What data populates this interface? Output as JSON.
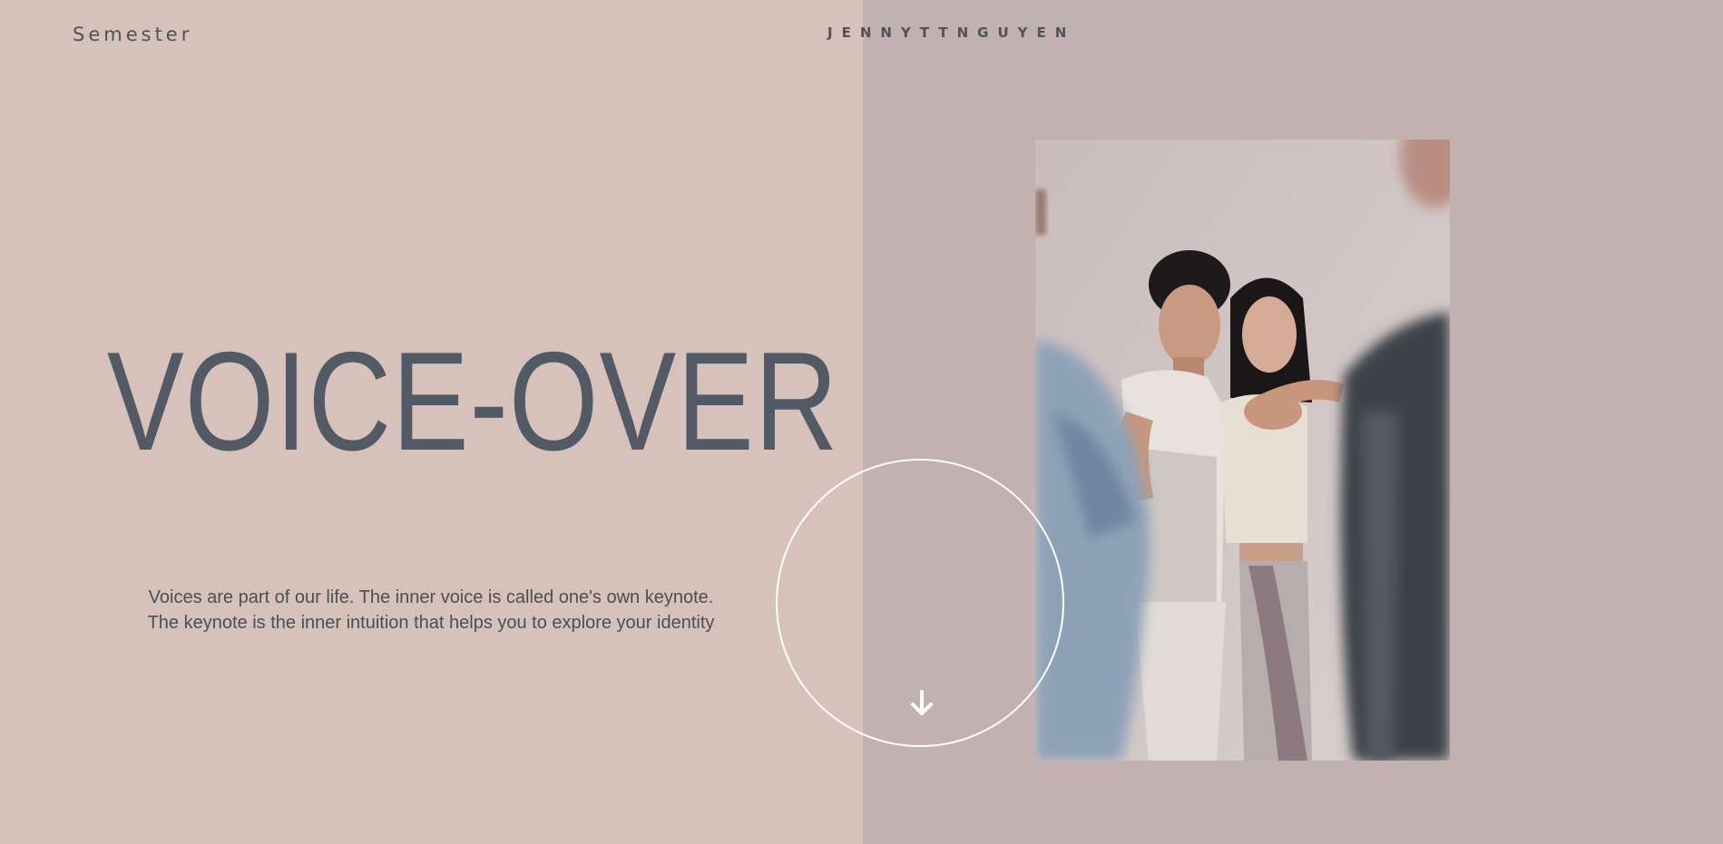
{
  "header": {
    "brand_label": "Semester",
    "author_label": "JENNYTTNGUYEN"
  },
  "hero": {
    "title": "VOICE-OVER",
    "intro_line1": "Voices are part of our life. The inner voice is called one's own keynote.",
    "intro_line2": "The keynote is the inner intuition that helps you to explore your identity"
  },
  "icons": {
    "scroll": "arrow-down-icon"
  },
  "colors": {
    "left_panel": "#d6c2ba",
    "right_panel": "#c1b1b0",
    "text": "#525a66",
    "circle": "#ffffff"
  }
}
